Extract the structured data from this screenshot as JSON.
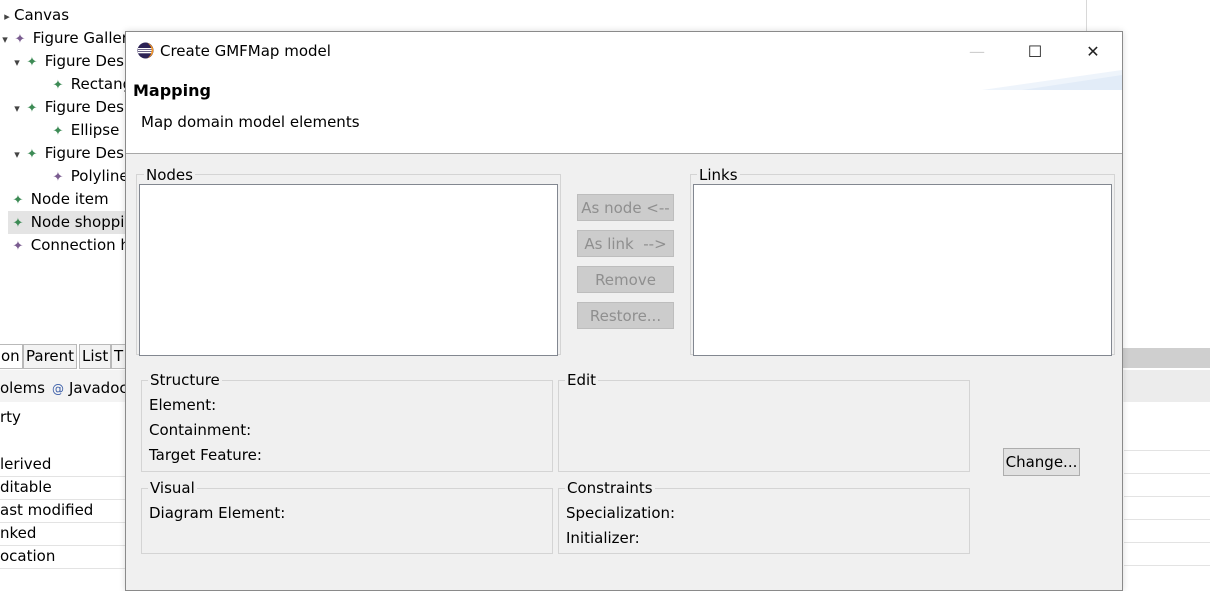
{
  "background": {
    "tree": [
      {
        "label": "Canvas",
        "icon": "none",
        "twisty": "▸"
      },
      {
        "label": "Figure Gallery",
        "icon": "purple",
        "twisty": "▾"
      },
      {
        "label": "Figure Des",
        "icon": "green",
        "twisty": "▾"
      },
      {
        "label": "Rectang",
        "icon": "green",
        "twisty": ""
      },
      {
        "label": "Figure Des",
        "icon": "green",
        "twisty": "▾"
      },
      {
        "label": "Ellipse",
        "icon": "green",
        "twisty": ""
      },
      {
        "label": "Figure Des",
        "icon": "green",
        "twisty": "▾"
      },
      {
        "label": "Polyline",
        "icon": "purple",
        "twisty": ""
      },
      {
        "label": "Node item",
        "icon": "green",
        "twisty": ""
      },
      {
        "label": "Node shoppi",
        "icon": "green",
        "twisty": ""
      },
      {
        "label": "Connection h",
        "icon": "purple",
        "twisty": ""
      }
    ],
    "bottom_tabs": [
      "on",
      "Parent",
      "List",
      "T"
    ],
    "views": {
      "problems": "olems",
      "javadoc": "Javadoc"
    },
    "properties": [
      "rty",
      "lerived",
      "ditable",
      "ast modified",
      "nked",
      "ocation"
    ]
  },
  "dialog": {
    "title": "Create GMFMap model",
    "window_controls": {
      "minimize": "—",
      "maximize": "☐",
      "close": "✕"
    },
    "banner": {
      "title": "Mapping",
      "description": "Map domain model elements"
    },
    "nodes_label": "Nodes",
    "links_label": "Links",
    "buttons": {
      "as_node": "As node <--",
      "as_link": "As link  -->",
      "remove": "Remove",
      "restore": "Restore...",
      "change": "Change..."
    },
    "structure": {
      "label": "Structure",
      "element": "Element:",
      "containment": "Containment:",
      "target_feature": "Target Feature:"
    },
    "edit": {
      "label": "Edit"
    },
    "visual": {
      "label": "Visual",
      "diagram_element": "Diagram Element:"
    },
    "constraints": {
      "label": "Constraints",
      "specialization": "Specialization:",
      "initializer": "Initializer:"
    }
  },
  "colors": {
    "icon_green": "#3d8b55",
    "icon_purple": "#7a5c90",
    "disabled_button_bg": "#cccccc",
    "dialog_bg": "#f0f0f0"
  }
}
